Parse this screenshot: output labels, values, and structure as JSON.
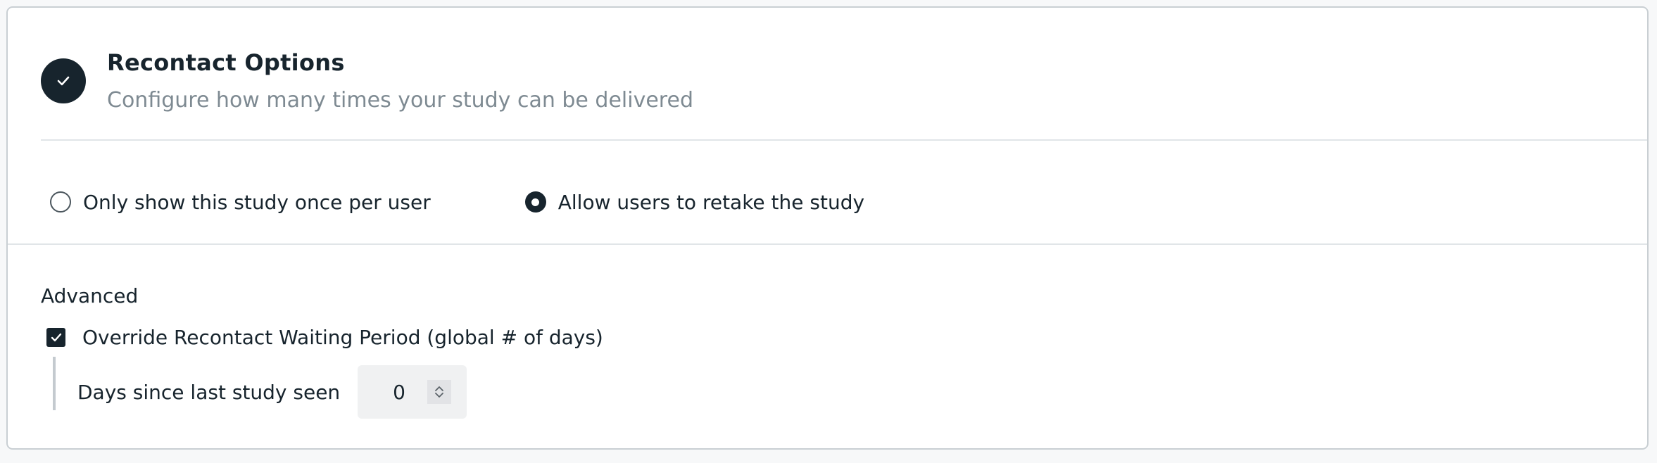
{
  "header": {
    "title": "Recontact Options",
    "subtitle": "Configure how many times your study can be delivered",
    "status_icon": "check-circle-icon"
  },
  "recontact": {
    "options": [
      {
        "label": "Only show this study once per user",
        "selected": false
      },
      {
        "label": "Allow users to retake the study",
        "selected": true
      }
    ]
  },
  "advanced": {
    "title": "Advanced",
    "override_checkbox": {
      "label": "Override Recontact Waiting Period (global # of days)",
      "checked": true
    },
    "days_field": {
      "label": "Days since last study seen",
      "value": "0"
    }
  },
  "colors": {
    "primary_dark": "#17242d",
    "muted_text": "#7e8a92",
    "divider": "#e1e5e8",
    "input_bg": "#f0f1f2"
  }
}
